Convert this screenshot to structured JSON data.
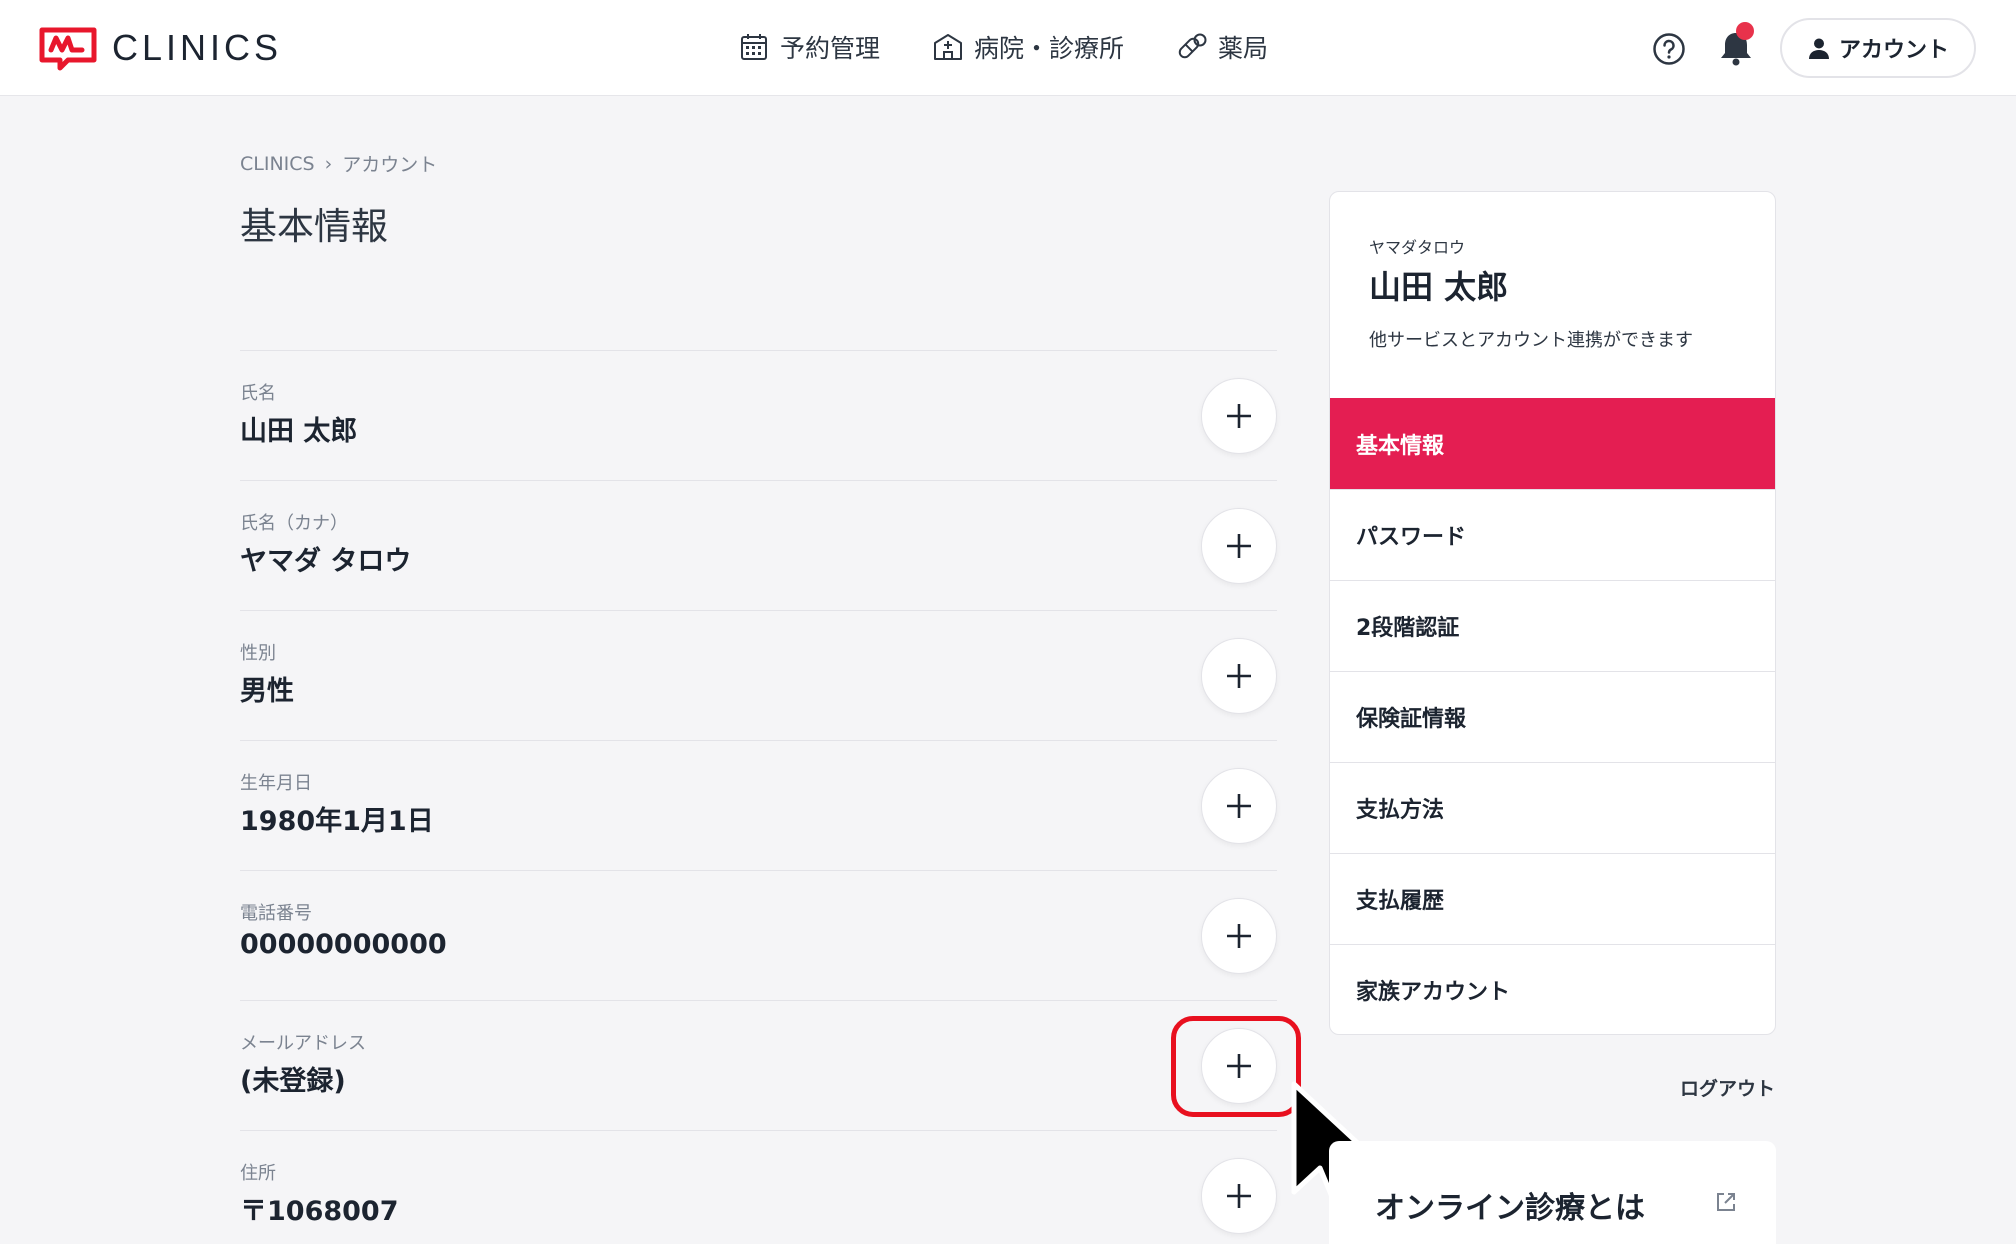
{
  "header": {
    "brand": "CLINICS",
    "nav": [
      {
        "label": "予約管理",
        "icon": "calendar-icon"
      },
      {
        "label": "病院・診療所",
        "icon": "hospital-icon"
      },
      {
        "label": "薬局",
        "icon": "pill-icon"
      }
    ],
    "help_icon": "help-icon",
    "bell_icon": "bell-icon",
    "account_label": "アカウント"
  },
  "breadcrumb": [
    "CLINICS",
    "アカウント"
  ],
  "breadcrumb_separator": "›",
  "page_title": "基本情報",
  "fields": [
    {
      "label": "氏名",
      "value": "山田 太郎"
    },
    {
      "label": "氏名（カナ）",
      "value": "ヤマダ タロウ"
    },
    {
      "label": "性別",
      "value": "男性"
    },
    {
      "label": "生年月日",
      "value": "1980年1月1日"
    },
    {
      "label": "電話番号",
      "value": "00000000000"
    },
    {
      "label": "メールアドレス",
      "value": "(未登録)"
    },
    {
      "label": "住所",
      "value": "〒1068007"
    }
  ],
  "sidebar": {
    "kana": "ヤマダタロウ",
    "name": "山田 太郎",
    "note": "他サービスとアカウント連携ができます",
    "menu": [
      "基本情報",
      "パスワード",
      "2段階認証",
      "保険証情報",
      "支払方法",
      "支払履歴",
      "家族アカウント"
    ],
    "active_index": 0
  },
  "logout_label": "ログアウト",
  "info_card": {
    "title": "オンライン診療とは"
  },
  "colors": {
    "accent": "#e41e52",
    "notification": "#e8324b",
    "highlight": "#e8101f"
  }
}
